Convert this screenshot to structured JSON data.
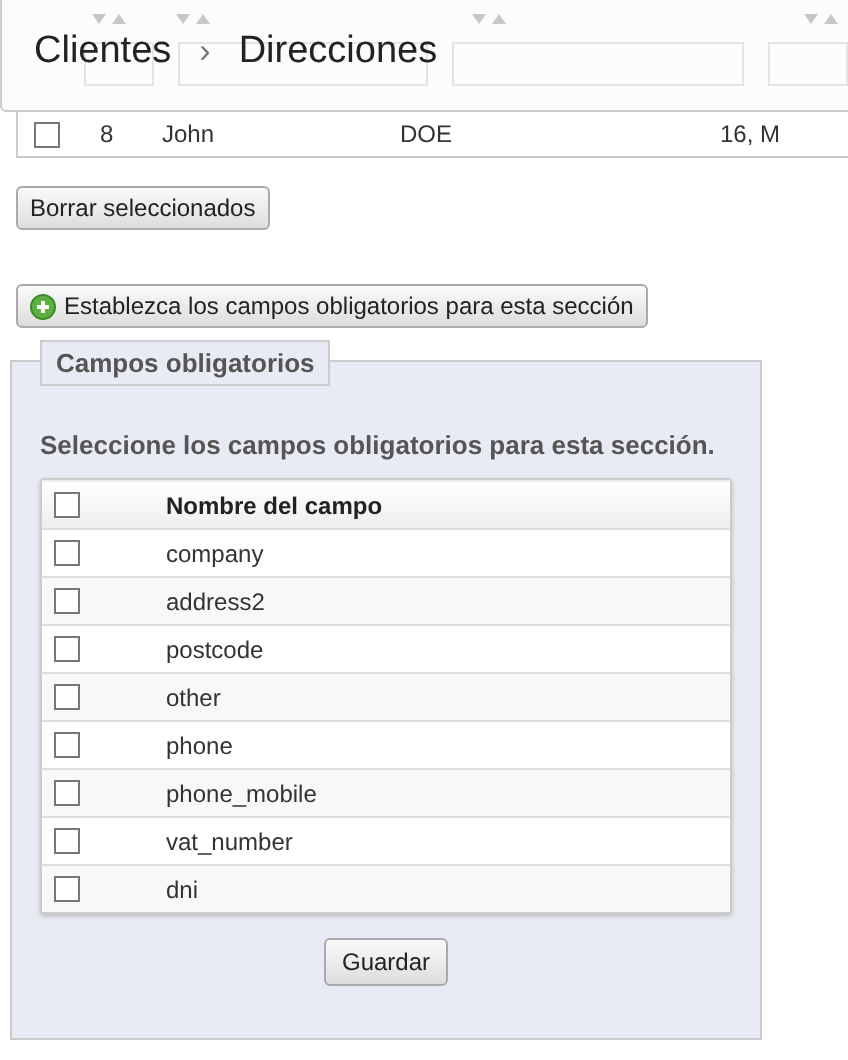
{
  "breadcrumb": {
    "items": [
      "Clientes",
      "Direcciones"
    ],
    "separator": "›"
  },
  "address_rows": [
    {
      "checked": false,
      "column_1": "8",
      "column_2": "John",
      "column_3": "DOE",
      "column_4": "16, M"
    }
  ],
  "delete_button": "Borrar seleccionados",
  "required_fields_button": "Establezca los campos obligatorios para esta sección",
  "fieldset": {
    "legend": "Campos obligatorios",
    "instructions": "Seleccione los campos obligatorios para esta sección.",
    "header": {
      "checked": false,
      "label": "Nombre del campo"
    },
    "fields": [
      {
        "name": "company",
        "checked": false
      },
      {
        "name": "address2",
        "checked": false
      },
      {
        "name": "postcode",
        "checked": false
      },
      {
        "name": "other",
        "checked": false
      },
      {
        "name": "phone",
        "checked": false
      },
      {
        "name": "phone_mobile",
        "checked": false
      },
      {
        "name": "vat_number",
        "checked": false
      },
      {
        "name": "dni",
        "checked": false
      }
    ],
    "save_button": "Guardar"
  }
}
